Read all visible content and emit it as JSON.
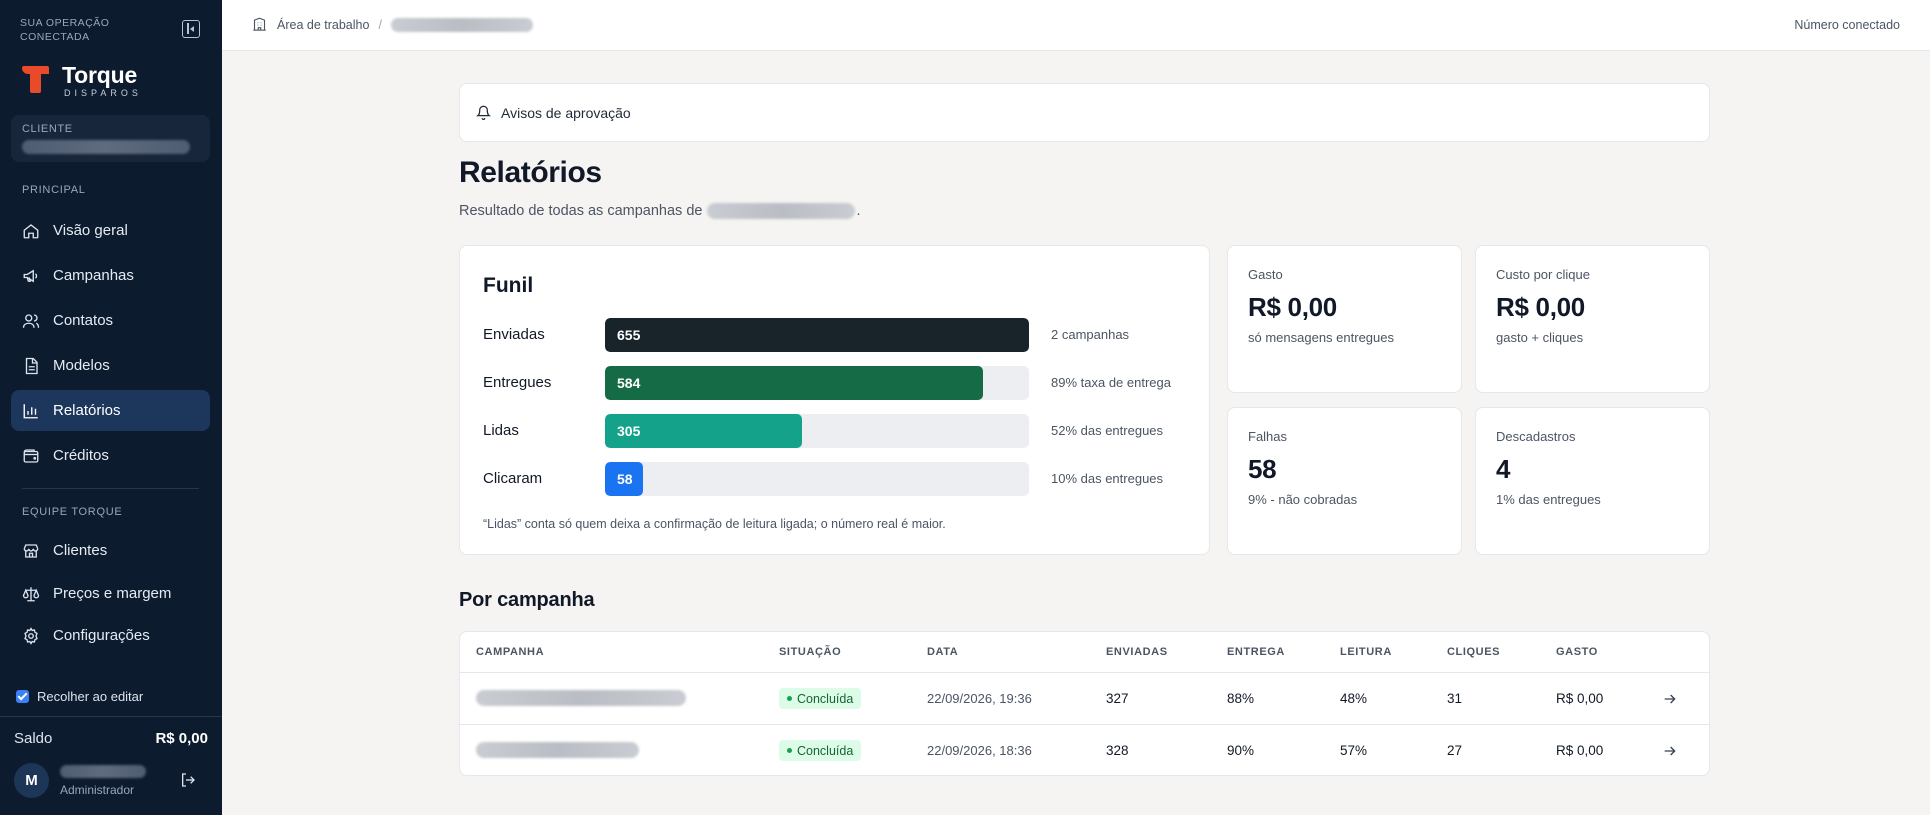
{
  "sidebar": {
    "operation_label": "SUA OPERAÇÃO CONECTADA",
    "brand": {
      "name": "Torque",
      "sub": "DISPAROS",
      "accent": "#e84a2a"
    },
    "client_label": "CLIENTE",
    "section_principal": "PRINCIPAL",
    "nav_principal": [
      {
        "label": "Visão geral",
        "icon": "home-icon"
      },
      {
        "label": "Campanhas",
        "icon": "megaphone-icon"
      },
      {
        "label": "Contatos",
        "icon": "users-icon"
      },
      {
        "label": "Modelos",
        "icon": "document-icon"
      },
      {
        "label": "Relatórios",
        "icon": "bar-chart-icon",
        "active": true
      },
      {
        "label": "Créditos",
        "icon": "wallet-icon"
      }
    ],
    "section_equipe": "EQUIPE TORQUE",
    "nav_equipe": [
      {
        "label": "Clientes",
        "icon": "store-icon"
      },
      {
        "label": "Preços e margem",
        "icon": "scale-icon"
      },
      {
        "label": "Configurações",
        "icon": "gear-icon"
      }
    ],
    "recolher_label": "Recolher ao editar",
    "saldo_label": "Saldo",
    "saldo_value": "R$ 0,00",
    "avatar_initial": "M",
    "user_role": "Administrador"
  },
  "topbar": {
    "breadcrumb_root": "Área de trabalho",
    "breadcrumb_sep": "/",
    "right_status": "Número conectado"
  },
  "main": {
    "avisos_label": "Avisos de aprovação",
    "title": "Relatórios",
    "subtitle_prefix": "Resultado de todas as campanhas de",
    "subtitle_suffix": ".",
    "funil": {
      "title": "Funil",
      "max": 655,
      "rows": [
        {
          "label": "Enviadas",
          "value": 655,
          "value_text": "655",
          "note": "2 campanhas",
          "color": "#18232a"
        },
        {
          "label": "Entregues",
          "value": 584,
          "value_text": "584",
          "note": "89% taxa de entrega",
          "color": "#146b45"
        },
        {
          "label": "Lidas",
          "value": 305,
          "value_text": "305",
          "note": "52% das entregues",
          "color": "#14a38a"
        },
        {
          "label": "Clicaram",
          "value": 58,
          "value_text": "58",
          "note": "10% das entregues",
          "color": "#1a73f0"
        }
      ],
      "footnote": "“Lidas” conta só quem deixa a confirmação de leitura ligada; o número real é maior."
    },
    "kpis": [
      {
        "label": "Gasto",
        "value": "R$ 0,00",
        "sub": "só mensagens entregues"
      },
      {
        "label": "Custo por clique",
        "value": "R$ 0,00",
        "sub": "gasto + cliques"
      },
      {
        "label": "Falhas",
        "value": "58",
        "sub": "9% - não cobradas"
      },
      {
        "label": "Descadastros",
        "value": "4",
        "sub": "1% das entregues"
      }
    ],
    "por_campanha_title": "Por campanha",
    "table": {
      "headers": [
        "CAMPANHA",
        "SITUAÇÃO",
        "DATA",
        "ENVIADAS",
        "ENTREGA",
        "LEITURA",
        "CLIQUES",
        "GASTO"
      ],
      "rows": [
        {
          "status": "Concluída",
          "date": "22/09/2026, 19:36",
          "enviadas": "327",
          "entrega": "88%",
          "leitura": "48%",
          "cliques": "31",
          "gasto": "R$ 0,00"
        },
        {
          "status": "Concluída",
          "date": "22/09/2026, 18:36",
          "enviadas": "328",
          "entrega": "90%",
          "leitura": "57%",
          "cliques": "27",
          "gasto": "R$ 0,00"
        }
      ]
    }
  }
}
